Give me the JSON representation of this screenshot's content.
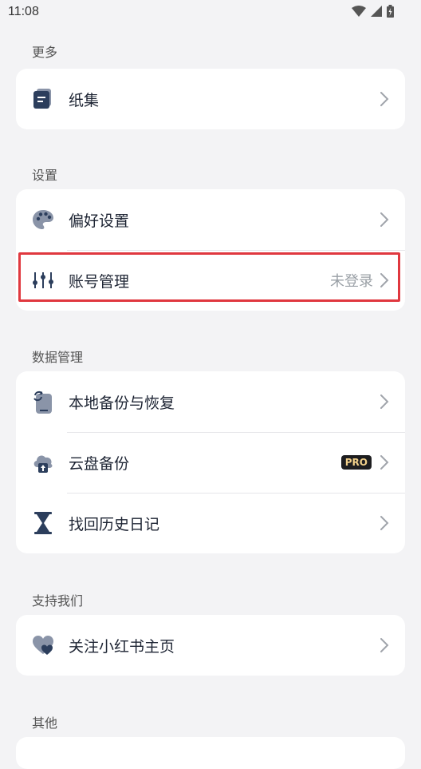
{
  "status_bar": {
    "time": "11:08"
  },
  "sections": {
    "more": {
      "title": "更多",
      "items": [
        {
          "label": "纸集",
          "icon": "paper-collection-icon"
        }
      ]
    },
    "settings": {
      "title": "设置",
      "items": [
        {
          "label": "偏好设置",
          "icon": "palette-icon"
        },
        {
          "label": "账号管理",
          "icon": "sliders-icon",
          "value": "未登录"
        }
      ]
    },
    "data_management": {
      "title": "数据管理",
      "items": [
        {
          "label": "本地备份与恢复",
          "icon": "phone-sync-icon"
        },
        {
          "label": "云盘备份",
          "icon": "cloud-upload-icon",
          "badge": "PRO"
        },
        {
          "label": "找回历史日记",
          "icon": "hourglass-icon"
        }
      ]
    },
    "support": {
      "title": "支持我们",
      "items": [
        {
          "label": "关注小红书主页",
          "icon": "heart-icon"
        }
      ]
    },
    "other": {
      "title": "其他"
    }
  },
  "colors": {
    "accent": "#2c3e5c",
    "highlight": "#e0383f",
    "pro_text": "#f2d08a"
  }
}
